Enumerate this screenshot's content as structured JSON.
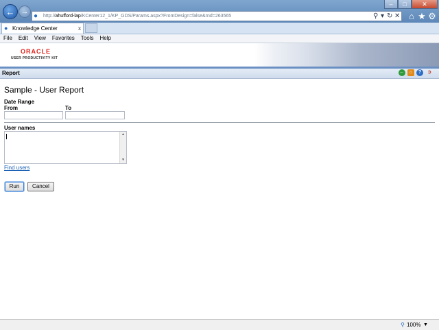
{
  "browser": {
    "address_url_prefix": "http://",
    "address_host": "ahufford-lap",
    "address_path": "/KCenter12_1/KP_GDS/Params.aspx?FromDesign=false&rnd=263565",
    "tab_title": "Knowledge Center",
    "tab_close": "x",
    "menu": [
      "File",
      "Edit",
      "View",
      "Favorites",
      "Tools",
      "Help"
    ],
    "zoom": "100%"
  },
  "banner": {
    "logo_text": "ORACLE",
    "product_text": "USER PRODUCTIVITY KIT"
  },
  "report_bar": {
    "label": "Report"
  },
  "form": {
    "title": "Sample - User Report",
    "date_range_label": "Date Range",
    "from_label": "From",
    "from_value": "",
    "to_label": "To",
    "to_value": "",
    "user_names_label": "User names",
    "user_names_value": "",
    "find_users_link": "Find users",
    "run_label": "Run",
    "cancel_label": "Cancel"
  },
  "icons": {
    "back": "back-arrow-icon",
    "forward": "forward-arrow-icon",
    "report_back": "green-back-icon",
    "home": "home-icon",
    "help": "help-icon",
    "logout": "logout-icon"
  },
  "colors": {
    "oracle_red": "#e0221b",
    "link_blue": "#1a5fb4",
    "report_bar": "#d7e2f0"
  }
}
